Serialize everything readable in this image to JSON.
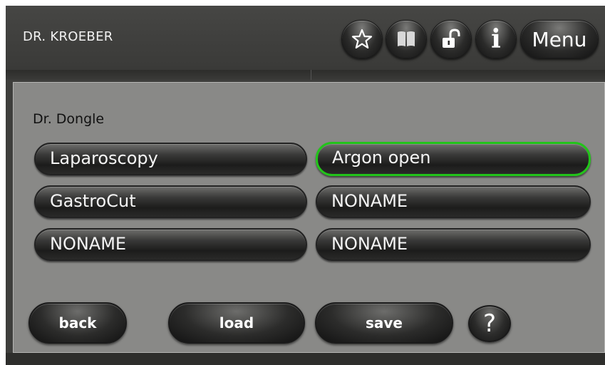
{
  "header": {
    "user_name": "DR. KROEBER",
    "icons": [
      "star-icon",
      "book-icon",
      "unlock-icon",
      "info-icon"
    ],
    "info_glyph": "i",
    "menu_label": "Menu"
  },
  "panel": {
    "profile_name": "Dr. Dongle",
    "programs": [
      {
        "label": "Laparoscopy",
        "selected": false
      },
      {
        "label": "Argon open",
        "selected": true
      },
      {
        "label": "GastroCut",
        "selected": false
      },
      {
        "label": "NONAME",
        "selected": false
      },
      {
        "label": "NONAME",
        "selected": false
      },
      {
        "label": "NONAME",
        "selected": false
      }
    ]
  },
  "actions": {
    "back_label": "back",
    "load_label": "load",
    "save_label": "save",
    "help_label": "?"
  },
  "colors": {
    "selected_outline": "#22c41a",
    "panel_background": "#898987",
    "header_background": "#3e3e3c"
  }
}
